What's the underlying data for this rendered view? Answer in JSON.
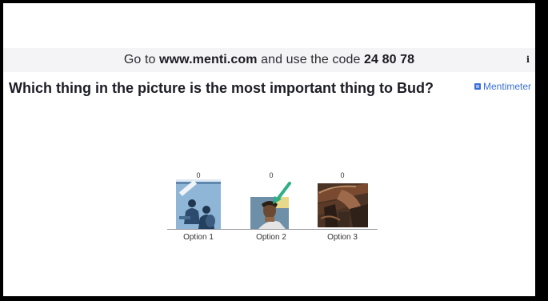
{
  "header": {
    "prefix": "Go to ",
    "url": "www.menti.com",
    "middle": " and use the code ",
    "code": "24 80 78",
    "info_icon": "info-icon",
    "info_glyph": "i"
  },
  "question": "Which thing in the picture is the most important thing to Bud?",
  "brand": {
    "name": "Mentimeter",
    "icon": "mentimeter-logo-icon"
  },
  "chart_data": {
    "type": "bar",
    "categories": [
      "Option 1",
      "Option 2",
      "Option 3"
    ],
    "values": [
      0,
      0,
      0
    ],
    "title": "",
    "xlabel": "",
    "ylabel": ""
  }
}
